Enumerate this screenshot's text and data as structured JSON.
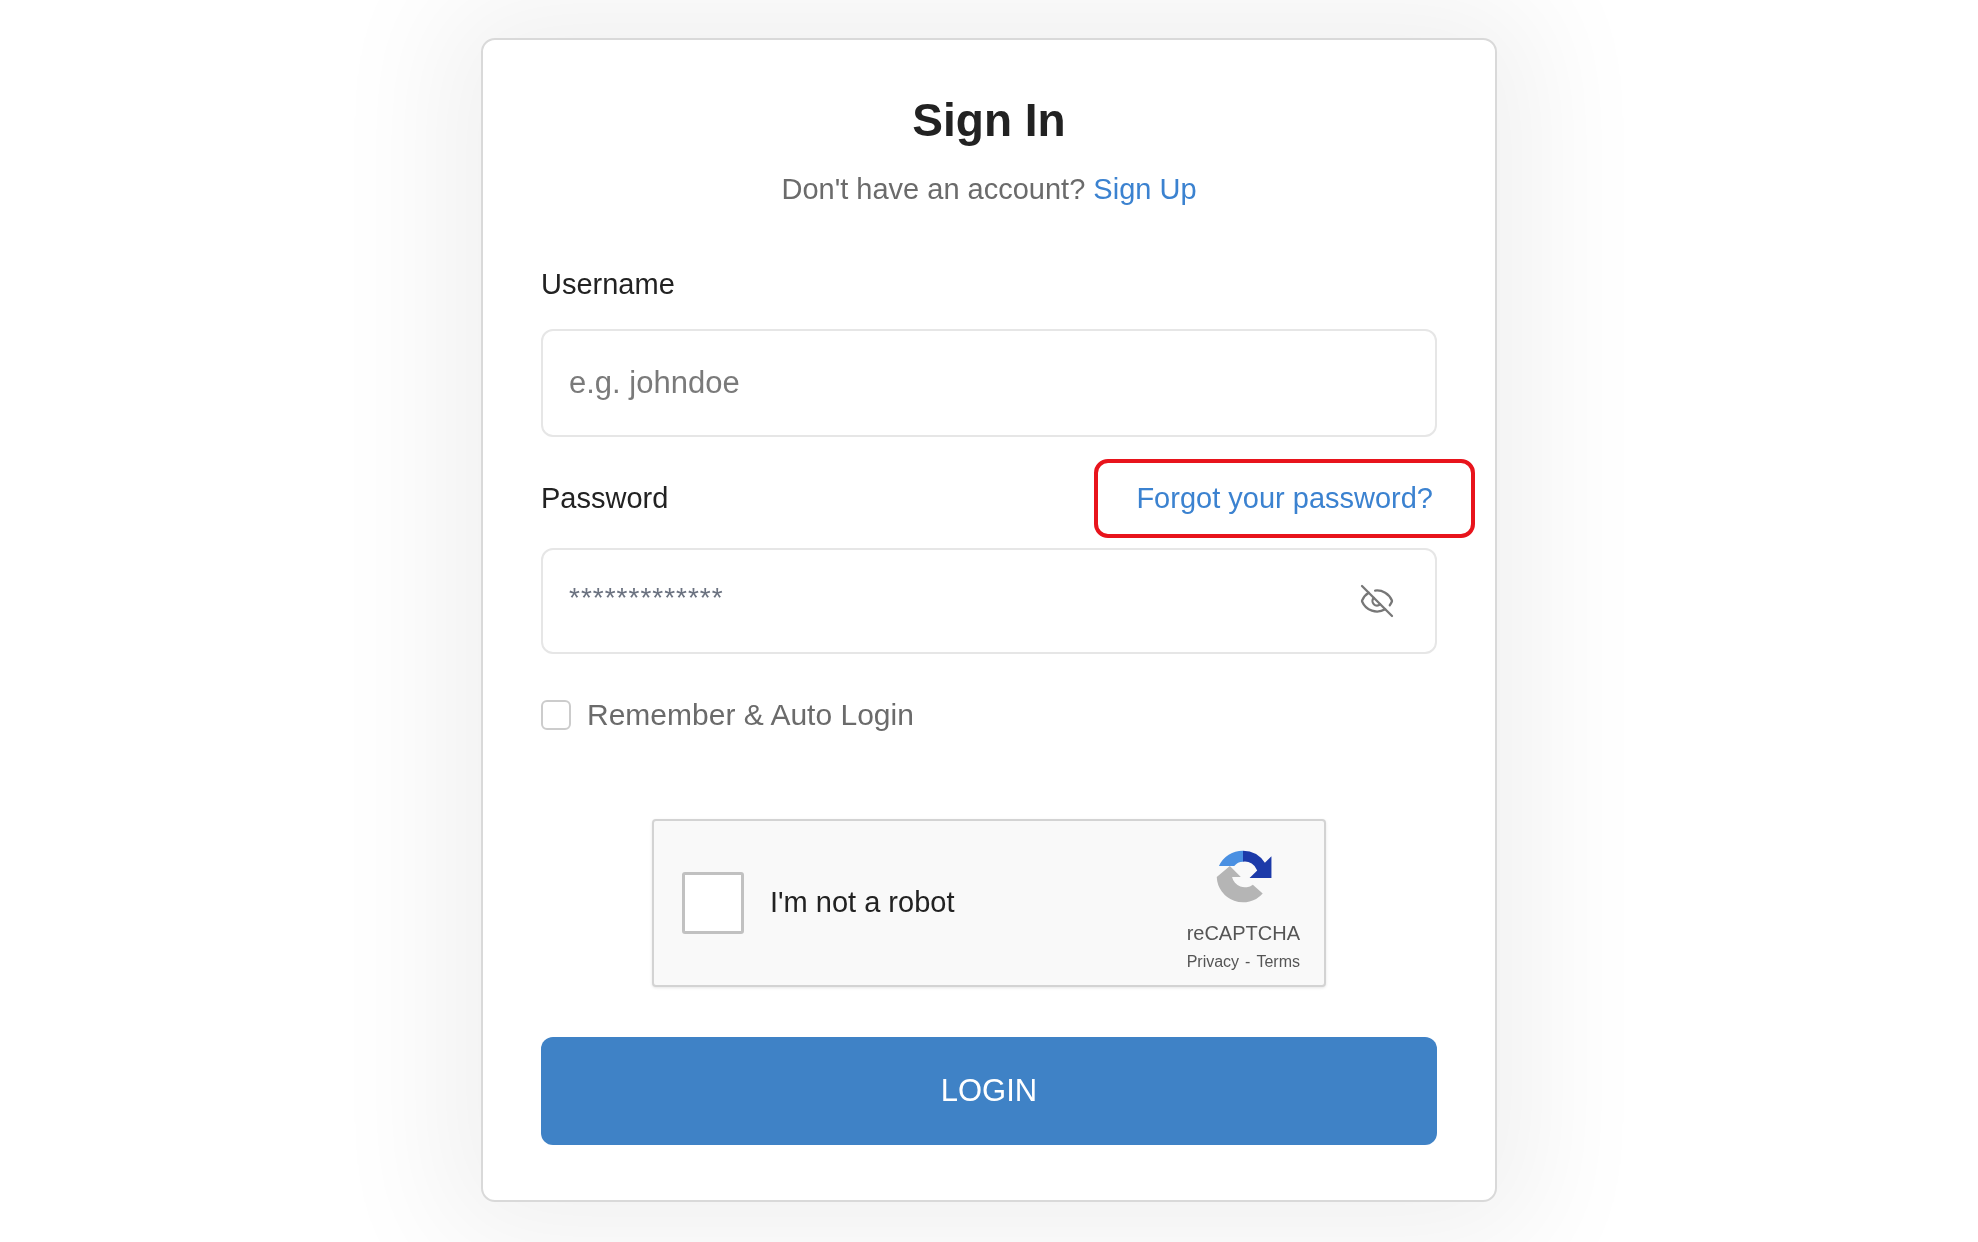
{
  "title": "Sign In",
  "signup_prompt": {
    "text": "Don't have an account?",
    "link": "Sign Up"
  },
  "username": {
    "label": "Username",
    "placeholder": "e.g. johndoe"
  },
  "password": {
    "label": "Password",
    "value": "*************",
    "forgot_link": {
      "label": "Forgot your password?",
      "highlighted": true
    }
  },
  "remember": {
    "label": "Remember & Auto Login",
    "checked": false
  },
  "captcha": {
    "label": "I'm not a robot",
    "checked": false,
    "brand": "reCAPTCHA",
    "privacy": "Privacy",
    "separator": "-",
    "terms": "Terms"
  },
  "login_button": "LOGIN"
}
